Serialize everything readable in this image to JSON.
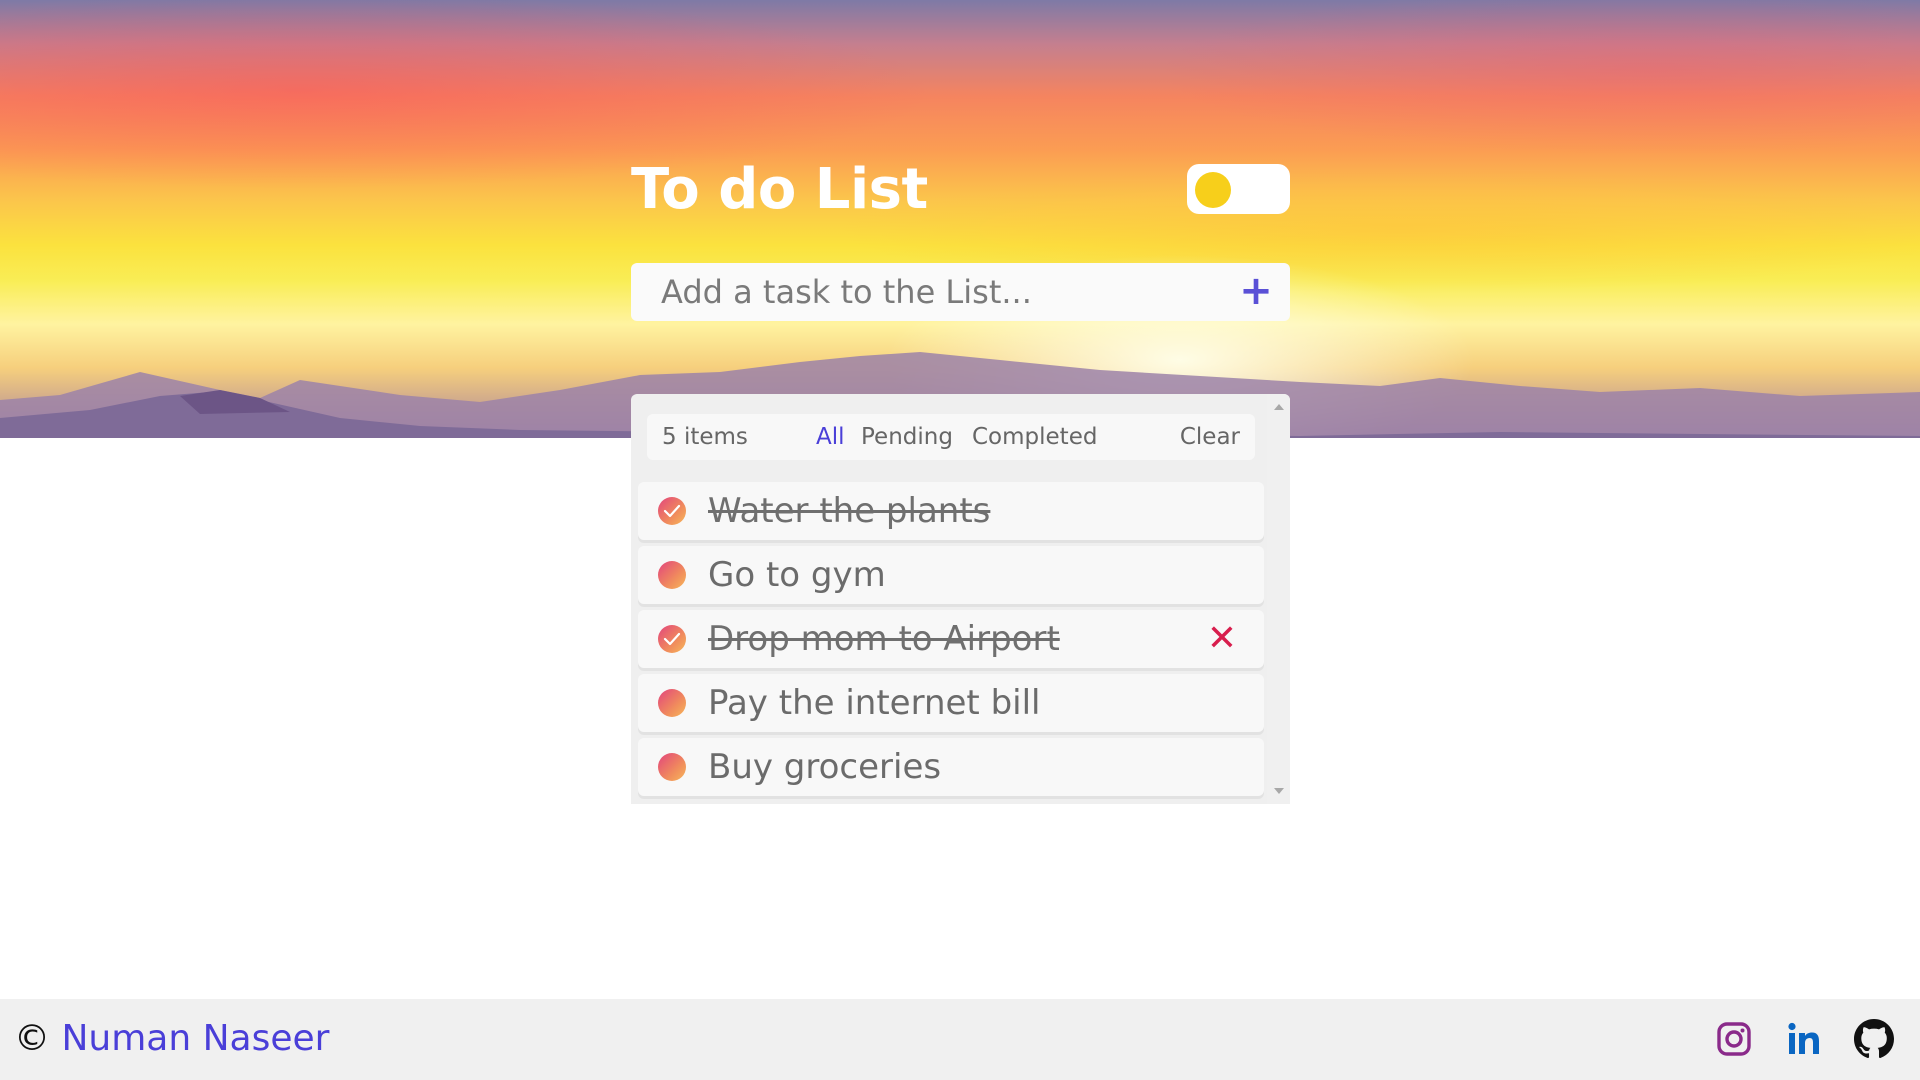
{
  "app": {
    "title": "To do List",
    "theme_toggle": {
      "state": "light"
    }
  },
  "add_task": {
    "placeholder": "Add a task to the List...",
    "add_icon": "plus-icon"
  },
  "filters": {
    "count_label": "5 items",
    "all_label": "All",
    "pending_label": "Pending",
    "completed_label": "Completed",
    "clear_label": "Clear",
    "active": "All"
  },
  "tasks": [
    {
      "text": "Water the plants",
      "completed": true
    },
    {
      "text": "Go to gym",
      "completed": false
    },
    {
      "text": "Drop mom to Airport",
      "completed": true
    },
    {
      "text": "Pay the internet bill",
      "completed": false
    },
    {
      "text": "Buy groceries",
      "completed": false
    }
  ],
  "footer": {
    "copyright_symbol": "©",
    "author": "Numan Naseer",
    "social": [
      "instagram-icon",
      "linkedin-icon",
      "github-icon"
    ]
  },
  "colors": {
    "accent": "#4a3fd8",
    "delete": "#d81e4d",
    "toggle_knob": "#f7cf1b",
    "instagram": "#8a2a8a",
    "linkedin": "#0a66c2"
  }
}
